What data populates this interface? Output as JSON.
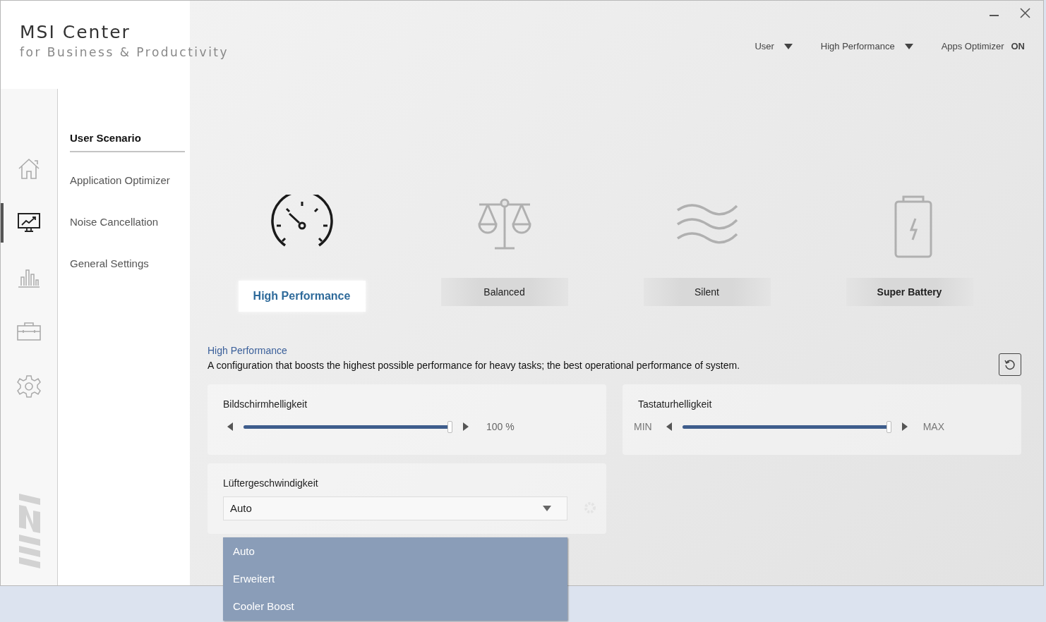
{
  "app": {
    "title": "MSI Center",
    "subtitle": "for Business & Productivity"
  },
  "top_bar": [
    {
      "kind": "dropdown",
      "label": "User"
    },
    {
      "kind": "dropdown",
      "label": "High Performance"
    },
    {
      "kind": "toggle",
      "label": "Apps Optimizer",
      "value": "ON"
    }
  ],
  "icon_rail": [
    {
      "kind": "home",
      "selected": false
    },
    {
      "kind": "monitor",
      "selected": true
    },
    {
      "kind": "bars",
      "selected": false
    },
    {
      "kind": "toolbox",
      "selected": false
    },
    {
      "kind": "gear",
      "selected": false
    }
  ],
  "nav": [
    {
      "label": "User Scenario",
      "selected": true
    },
    {
      "label": "Application Optimizer",
      "selected": false
    },
    {
      "label": "Noise Cancellation",
      "selected": false
    },
    {
      "label": "General Settings",
      "selected": false
    }
  ],
  "scenarios": [
    {
      "kind": "speedometer",
      "label": "High Performance",
      "selected": true
    },
    {
      "kind": "scale",
      "label": "Balanced",
      "selected": false
    },
    {
      "kind": "waves",
      "label": "Silent",
      "selected": false
    },
    {
      "kind": "battery",
      "label": "Super Battery",
      "selected": false
    }
  ],
  "description": {
    "title": "High Performance",
    "text": "A configuration that boosts the highest possible performance for heavy tasks; the best operational performance of system."
  },
  "sliders": [
    {
      "label": "Bildschirmhelligkeit",
      "level": 1.0,
      "reading": "100 %"
    },
    {
      "label": "Tastaturhelligkeit",
      "level": 1.0,
      "min_text": "MIN",
      "max_text": "MAX"
    }
  ],
  "fan": {
    "label": "Lüftergeschwindigkeit",
    "value": "Auto",
    "expanded": true,
    "options": [
      {
        "label": "Auto"
      },
      {
        "label": "Erweitert"
      },
      {
        "label": "Cooler Boost"
      }
    ]
  }
}
